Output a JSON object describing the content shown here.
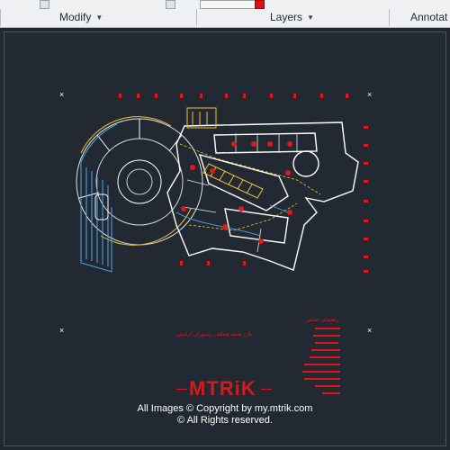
{
  "ribbon": {
    "panels": [
      {
        "label": "Modify"
      },
      {
        "label": "Layers"
      },
      {
        "label": "Annotat"
      }
    ]
  },
  "drawing": {
    "caption": "پلان طبقه همکف رستوران ارامش",
    "legend_title": "راهنمای عناصر",
    "logo": "MTRiK",
    "copyright_line1": "All Images © Copyright by my.mtrik.com",
    "copyright_line2": "© All Rights reserved."
  },
  "colors": {
    "background": "#212830",
    "accent_red": "#e01818",
    "walls": "#ffffff",
    "stairs": "#f2c12e",
    "circulation": "#4da6e8"
  }
}
